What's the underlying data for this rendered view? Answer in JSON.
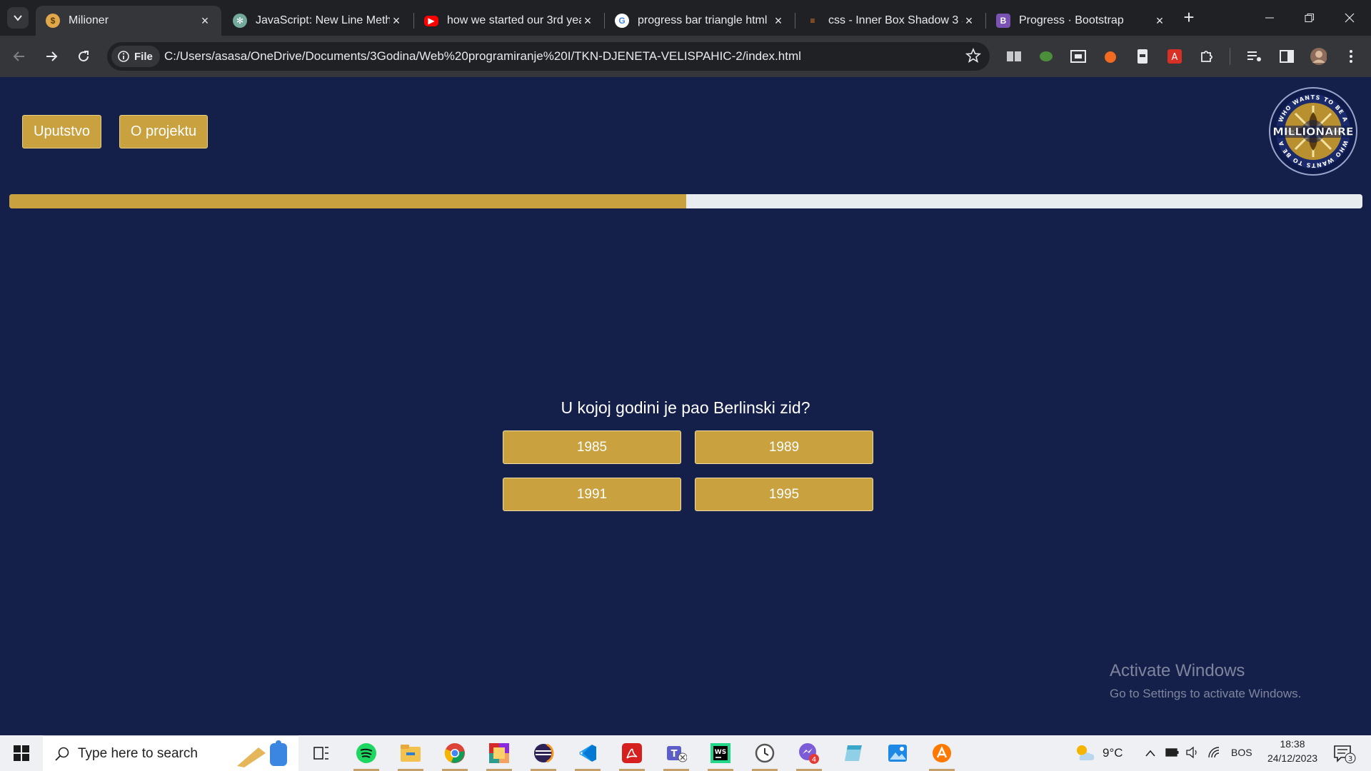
{
  "browser": {
    "tabs": [
      {
        "title": "Milioner",
        "active": true
      },
      {
        "title": "JavaScript: New Line Metho",
        "active": false
      },
      {
        "title": "how we started our 3rd yea",
        "active": false
      },
      {
        "title": "progress bar triangle html",
        "active": false
      },
      {
        "title": "css - Inner Box Shadow 3 S",
        "active": false
      },
      {
        "title": "Progress · Bootstrap",
        "active": false
      }
    ],
    "address": {
      "scheme_label": "File",
      "url": "C:/Users/asasa/OneDrive/Documents/3Godina/Web%20programiranje%20I/TKN-DJENETA-VELISPAHIC-2/index.html"
    }
  },
  "page": {
    "nav_buttons": {
      "instructions": "Uputstvo",
      "about": "O projektu"
    },
    "logo": {
      "top_text": "WHO WANTS TO BE A",
      "title": "MILLIONAIRE",
      "bottom_text": "WHO WANTS TO BE A"
    },
    "progress": {
      "fraction": 0.5
    },
    "question": "U kojoj godini je pao Berlinski zid?",
    "answers": [
      "1985",
      "1989",
      "1991",
      "1995"
    ]
  },
  "watermark": {
    "line1": "Activate Windows",
    "line2": "Go to Settings to activate Windows."
  },
  "taskbar": {
    "search_placeholder": "Type here to search",
    "weather": "9°C",
    "language": "BOS",
    "time": "18:38",
    "date": "24/12/2023",
    "notification_count": "3",
    "app_badge": "4"
  },
  "colors": {
    "gold": "#c9a13f",
    "navy": "#14204a",
    "track": "#e9ecef"
  }
}
